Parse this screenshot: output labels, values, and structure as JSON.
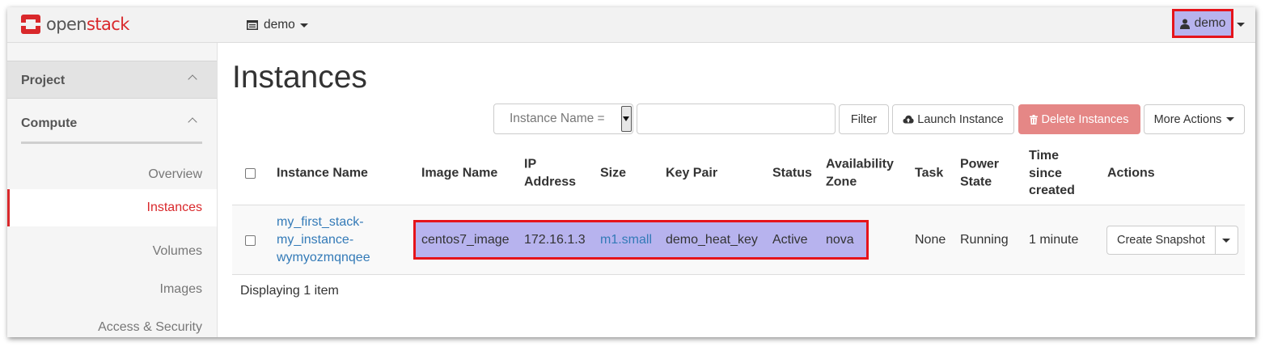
{
  "app": {
    "logo_text_first": "open",
    "logo_text_second": "stack",
    "brand_color": "#d9282b"
  },
  "navbar": {
    "project_label": "demo",
    "project_icon": "project-list-icon",
    "user_label": "demo",
    "user_icon": "user-icon"
  },
  "sidebar": {
    "sections": [
      {
        "label": "Project",
        "expanded": true
      },
      {
        "label": "Compute",
        "expanded": true
      }
    ],
    "items": [
      {
        "label": "Overview",
        "active": false
      },
      {
        "label": "Instances",
        "active": true
      },
      {
        "label": "Volumes",
        "active": false
      },
      {
        "label": "Images",
        "active": false
      },
      {
        "label": "Access & Security",
        "active": false
      }
    ]
  },
  "main": {
    "title": "Instances",
    "filter": {
      "select_value": "Instance Name =",
      "input_value": "",
      "filter_label": "Filter"
    },
    "actions": {
      "launch_label": "Launch Instance",
      "delete_label": "Delete Instances",
      "more_label": "More Actions"
    },
    "table": {
      "headers": {
        "instance_name": "Instance Name",
        "image_name": "Image Name",
        "ip_line1": "IP",
        "ip_line2": "Address",
        "size": "Size",
        "key_pair": "Key Pair",
        "status": "Status",
        "az_line1": "Availability",
        "az_line2": "Zone",
        "task": "Task",
        "power_line1": "Power",
        "power_line2": "State",
        "time_line1": "Time",
        "time_line2": "since",
        "time_line3": "created",
        "actions": "Actions"
      },
      "rows": [
        {
          "name_line1": "my_first_stack-",
          "name_line2": "my_instance-",
          "name_line3": "wymyozmqnqee",
          "image_name": "centos7_image",
          "ip_address": "172.16.1.3",
          "size": "m1.small",
          "key_pair": "demo_heat_key",
          "status": "Active",
          "availability_zone": "nova",
          "task": "None",
          "power_state": "Running",
          "time_since_created": "1 minute",
          "action_label": "Create Snapshot"
        }
      ]
    },
    "footer": "Displaying 1 item"
  },
  "colors": {
    "highlight_fill": "#b7b3ee",
    "highlight_border": "#e5141b",
    "danger_button": "#e58786",
    "link": "#337ab7"
  }
}
